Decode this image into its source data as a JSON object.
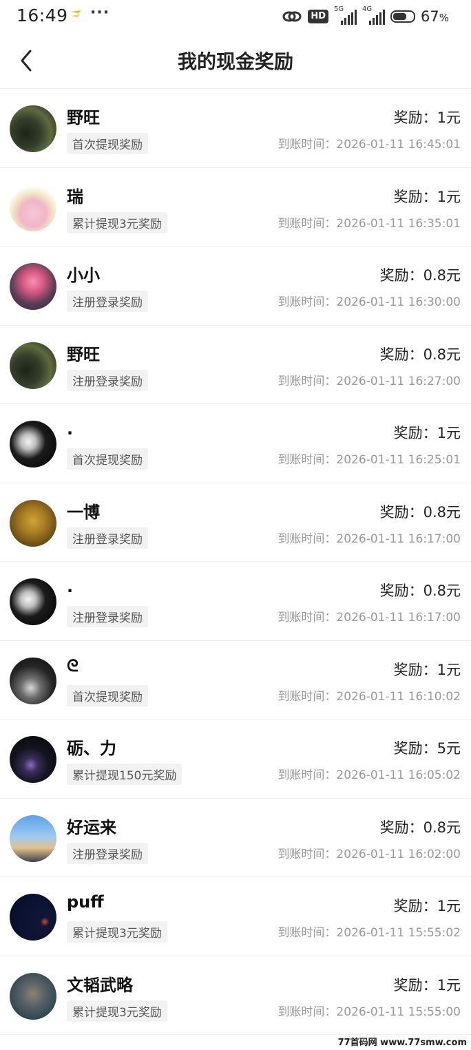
{
  "status_bar": {
    "time": "16:49",
    "more": "···",
    "hd": "HD",
    "net1": "5G",
    "net2": "4G",
    "battery_percent": "67",
    "battery_unit": "%",
    "battery_level": 0.67
  },
  "header": {
    "back_icon": "chevron-left-icon",
    "title": "我的现金奖励"
  },
  "rewards": [
    {
      "name": "野旺",
      "tag": "首次提现奖励",
      "reward": "奖励：1元",
      "time": "到账时间：2026-01-11 16:45:01",
      "avatar": "dark-forest-bikes-avatar"
    },
    {
      "name": "瑞",
      "tag": "累计提现3元奖励",
      "reward": "奖励：1元",
      "time": "到账时间：2026-01-11 16:35:01",
      "avatar": "cartoon-character-avatar"
    },
    {
      "name": "小小",
      "tag": "注册登录奖励",
      "reward": "奖励：0.8元",
      "time": "到账时间：2026-01-11 16:30:00",
      "avatar": "pink-tree-avatar"
    },
    {
      "name": "野旺",
      "tag": "注册登录奖励",
      "reward": "奖励：0.8元",
      "time": "到账时间：2026-01-11 16:27:00",
      "avatar": "dark-forest-bikes-avatar"
    },
    {
      "name": ".",
      "tag": "首次提现奖励",
      "reward": "奖励：1元",
      "time": "到账时间：2026-01-11 16:25:01",
      "avatar": "bw-silhouette-avatar"
    },
    {
      "name": "一博",
      "tag": "注册登录奖励",
      "reward": "奖励：0.8元",
      "time": "到账时间：2026-01-11 16:17:00",
      "avatar": "golden-portrait-avatar"
    },
    {
      "name": ".",
      "tag": "注册登录奖励",
      "reward": "奖励：0.8元",
      "time": "到账时间：2026-01-11 16:17:00",
      "avatar": "bw-silhouette-avatar"
    },
    {
      "name": "ᘓ",
      "tag": "首次提现奖励",
      "reward": "奖励：1元",
      "time": "到账时间：2026-01-11 16:10:02",
      "avatar": "car-night-avatar"
    },
    {
      "name": "砺、力",
      "tag": "累计提现150元奖励",
      "reward": "奖励：5元",
      "time": "到账时间：2026-01-11 16:05:02",
      "avatar": "night-city-avatar"
    },
    {
      "name": "好运来",
      "tag": "注册登录奖励",
      "reward": "奖励：0.8元",
      "time": "到账时间：2026-01-11 16:02:00",
      "avatar": "sky-person-avatar"
    },
    {
      "name": "puff",
      "tag": "累计提现3元奖励",
      "reward": "奖励：1元",
      "time": "到账时间：2026-01-11 15:55:02",
      "avatar": "dark-moon-avatar"
    },
    {
      "name": "文韬武略",
      "tag": "累计提现3元奖励",
      "reward": "奖励：1元",
      "time": "到账时间：2026-01-11 15:55:00",
      "avatar": "monkey-statue-avatar"
    }
  ],
  "watermark": "77首码网 www.77smw.com"
}
